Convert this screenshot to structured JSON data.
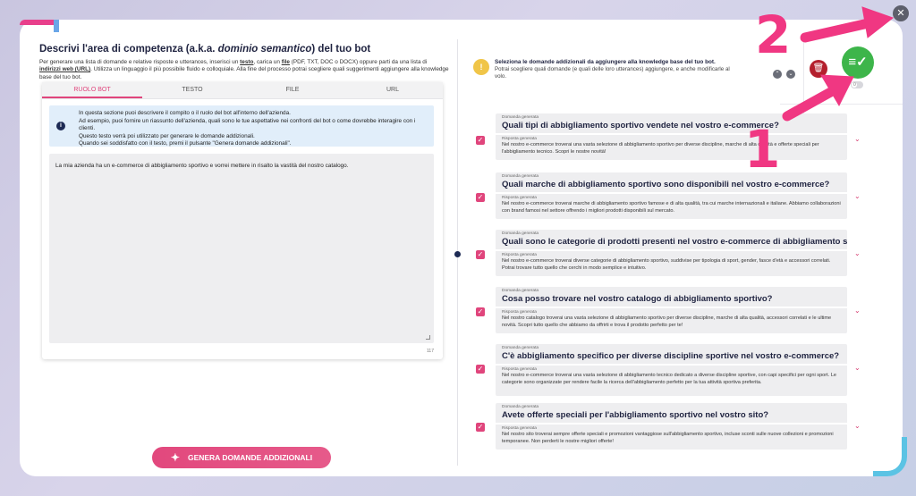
{
  "left": {
    "title_prefix": "Descrivi l'area di competenza (a.k.a. ",
    "title_em": "dominio semantico",
    "title_suffix": ") del tuo bot",
    "desc_1": "Per generare una lista di domande e relative risposte e utterances, inserisci un ",
    "desc_testo": "testo",
    "desc_2": ", carica un ",
    "desc_file": "file",
    "desc_3": " (PDF, TXT, DOC o DOCX) oppure parti da una lista di ",
    "desc_web": "indirizzi web (URL)",
    "desc_4": ". Utilizza un linguaggio il più possibile fluido e colloquiale. Alla fine del processo potrai scegliere quali suggerimenti aggiungere alla knowledge base del tuo bot.",
    "tabs": [
      "RUOLO BOT",
      "TESTO",
      "FILE",
      "URL"
    ],
    "info_lines": [
      "In questa sezione puoi descrivere il compito o il ruolo del bot all'interno dell'azienda.",
      "Ad esempio, puoi fornire un riassunto dell'azienda, quali sono le tue aspettative nei confronti del bot o come dovrebbe interagire con i clienti.",
      "Questo testo verrà poi utilizzato per generare le domande addizionali.",
      "Quando sei soddisfatto con il testo, premi il pulsante \"Genera domande addizionali\"."
    ],
    "textarea_value": "La mia azienda ha un e-commerce di abbigliamento sportivo e vorrei mettere in risalto la vastità del nostro catalogo.",
    "char_count": "117",
    "generate_button": "GENERA DOMANDE ADDIZIONALI"
  },
  "right": {
    "warn_title": "Seleziona le domande addizionali da aggiungere alla knowledge base del tuo bot.",
    "warn_text": "Potrai scegliere quali domande (e quali delle loro utterances) aggiungere, e anche modificarle al volo.",
    "toggle_label": "0",
    "question_label": "Domanda generata",
    "answer_label": "Risposta generata",
    "items": [
      {
        "q": "Quali tipi di abbigliamento sportivo vendete nel vostro e-commerce?",
        "a": "Nel nostro e-commerce troverai una vasta selezione di abbigliamento sportivo per diverse discipline, marche di alta qualità e offerte speciali per l'abbigliamento tecnico. Scopri le nostre novità!"
      },
      {
        "q": "Quali marche di abbigliamento sportivo sono disponibili nel vostro e-commerce?",
        "a": "Nel nostro e-commerce troverai marche di abbigliamento sportivo famose e di alta qualità, tra cui marche internazionali e italiane. Abbiamo collaborazioni con brand famosi nel settore offrendo i migliori prodotti disponibili sul mercato."
      },
      {
        "q": "Quali sono le categorie di prodotti presenti nel vostro e-commerce di abbigliamento sportivo?",
        "a": "Nel nostro e-commerce troverai diverse categorie di abbigliamento sportivo, suddivise per tipologia di sport, gender, fasce d'età e accessori correlati. Potrai trovare tutto quello che cerchi in modo semplice e intuitivo."
      },
      {
        "q": "Cosa posso trovare nel vostro catalogo di abbigliamento sportivo?",
        "a": "Nel nostro catalogo troverai una vasta selezione di abbigliamento sportivo per diverse discipline, marche di alta qualità, accessori correlati e le ultime novità. Scopri tutto quello che abbiamo da offrirti e trova il prodotto perfetto per te!"
      },
      {
        "q": "C'è abbigliamento specifico per diverse discipline sportive nel vostro e-commerce?",
        "a": "Nel nostro e-commerce troverai una vasta selezione di abbigliamento tecnico dedicato a diverse discipline sportive, con capi specifici per ogni sport. Le categorie sono organizzate per rendere facile la ricerca dell'abbigliamento perfetto per la tua attività sportiva preferita."
      },
      {
        "q": "Avete offerte speciali per l'abbigliamento sportivo nel vostro sito?",
        "a": "Nel nostro sito troverai sempre offerte speciali e promozioni vantaggiose sull'abbigliamento sportivo, incluse sconti sulle nuove collezioni e promozioni temporanee. Non perderti le nostre migliori offerte!"
      }
    ]
  },
  "annotations": {
    "n1": "1",
    "n2": "2"
  },
  "colors": {
    "accent": "#e0457c",
    "accept": "#3db54a",
    "delete": "#b41f2d",
    "warn": "#f0c548",
    "annotation": "#f03782"
  },
  "icons": {
    "close": "close-icon",
    "delete": "trash-icon",
    "accept": "add-list-icon",
    "warn": "warning-icon",
    "info": "info-icon",
    "sparkle": "sparkle-icon"
  }
}
